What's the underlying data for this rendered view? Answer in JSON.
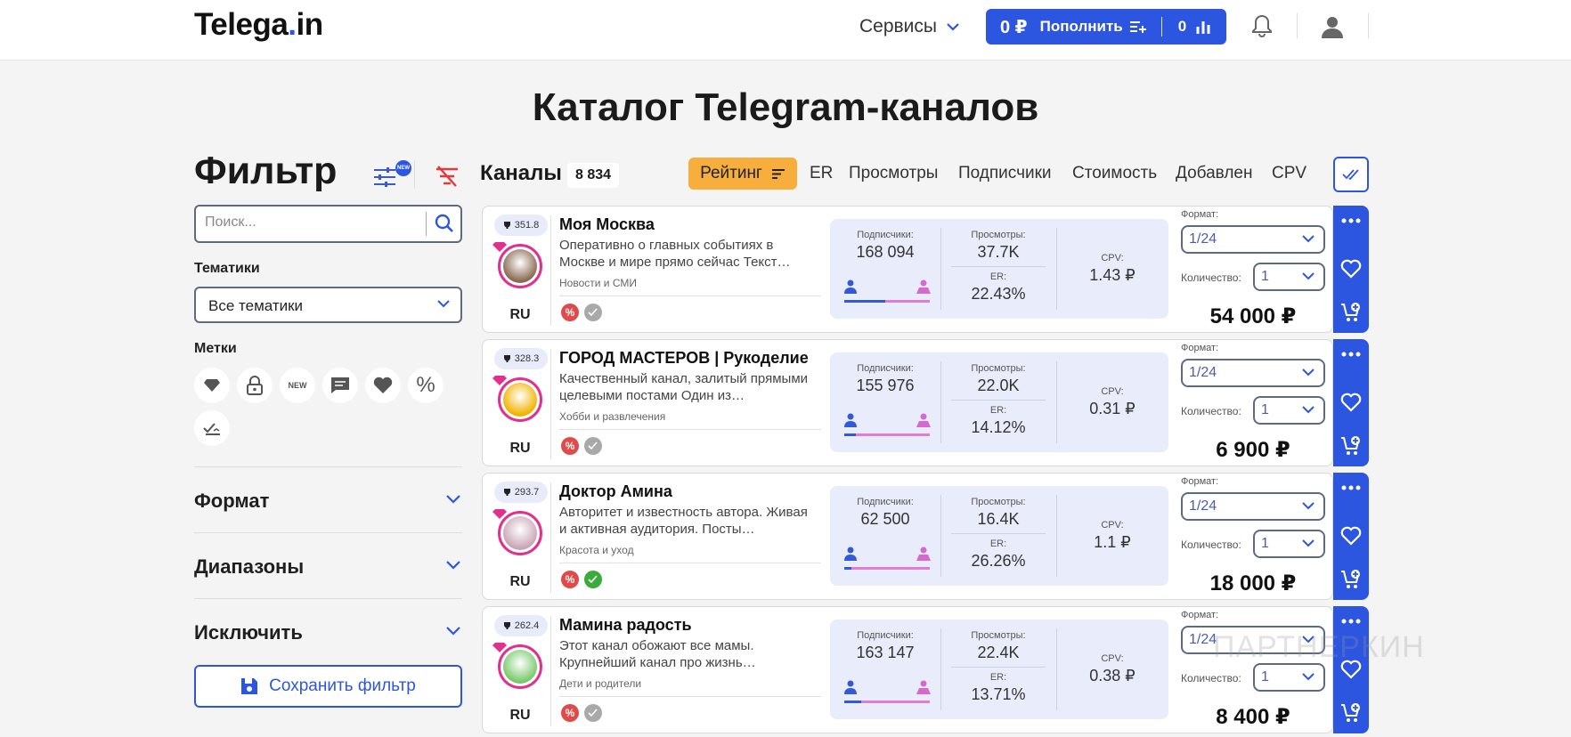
{
  "header": {
    "logo_part1": "Telega",
    "logo_dot": ".",
    "logo_part2": "in",
    "services_label": "Сервисы",
    "balance": "0 ₽",
    "topup_label": "Пополнить",
    "cart_count": "0"
  },
  "page_title": "Каталог Telegram-каналов",
  "filter": {
    "title": "Фильтр",
    "new_badge": "NEW",
    "search_placeholder": "Поиск...",
    "topics_label": "Тематики",
    "topics_value": "Все тематики",
    "tags_label": "Метки",
    "tag_new": "NEW",
    "tag_percent": "%",
    "format_label": "Формат",
    "ranges_label": "Диапазоны",
    "exclude_label": "Исключить",
    "save_label": "Сохранить фильтр"
  },
  "channels": {
    "title": "Каналы",
    "count": "8 834",
    "sort_active": "Рейтинг",
    "sort_options": [
      "ER",
      "Просмотры",
      "Подписчики",
      "Стоимость",
      "Добавлен",
      "CPV"
    ]
  },
  "labels": {
    "subscribers": "Подписчики:",
    "views": "Просмотры:",
    "er": "ER:",
    "cpv": "CPV:",
    "format": "Формат:",
    "quantity": "Количество:"
  },
  "cards": [
    {
      "rating": "351.8",
      "name": "Моя Москва",
      "description": "Оперативно о главных событиях в Москве и мире прямо сейчас Текст…",
      "category": "Новости и СМИ",
      "lang": "RU",
      "subscribers": "168 094",
      "views": "37.7K",
      "er": "22.43%",
      "cpv": "1.43 ₽",
      "format": "1/24",
      "quantity": "1",
      "price": "54 000 ₽",
      "male_share": 0.48,
      "avatar_color": "#8a6a52",
      "badge2_color": "#a9a9a9"
    },
    {
      "rating": "328.3",
      "name": "ГОРОД МАСТЕРОВ | Рукоделие",
      "description": "Качественный канал, залитый прямыми целевыми постами Один из…",
      "category": "Хобби и развлечения",
      "lang": "RU",
      "subscribers": "155 976",
      "views": "22.0K",
      "er": "14.12%",
      "cpv": "0.31 ₽",
      "format": "1/24",
      "quantity": "1",
      "price": "6 900 ₽",
      "male_share": 0.14,
      "avatar_color": "#f0b400",
      "badge2_color": "#a9a9a9"
    },
    {
      "rating": "293.7",
      "name": "Доктор Амина",
      "description": "Авторитет и известность автора. Живая и активная аудитория. Посты…",
      "category": "Красота и уход",
      "lang": "RU",
      "subscribers": "62 500",
      "views": "16.4K",
      "er": "26.26%",
      "cpv": "1.1 ₽",
      "format": "1/24",
      "quantity": "1",
      "price": "18 000 ₽",
      "male_share": 0.08,
      "avatar_color": "#c9a6b6",
      "badge2_color": "#3bab3b"
    },
    {
      "rating": "262.4",
      "name": "Мамина радость",
      "description": "Этот канал обожают все мамы. Крупнейший канал про жизнь…",
      "category": "Дети и родители",
      "lang": "RU",
      "subscribers": "163 147",
      "views": "22.4K",
      "er": "13.71%",
      "cpv": "0.38 ₽",
      "format": "1/24",
      "quantity": "1",
      "price": "8 400 ₽",
      "male_share": 0.2,
      "avatar_color": "#79c96b",
      "badge2_color": "#a9a9a9"
    }
  ],
  "watermark": "ПАРТНЕРКИН",
  "colors": {
    "accent": "#2d56e0",
    "sort_active": "#f8ae3c",
    "stats_bg": "#e9edfb",
    "pink": "#e0318c"
  }
}
